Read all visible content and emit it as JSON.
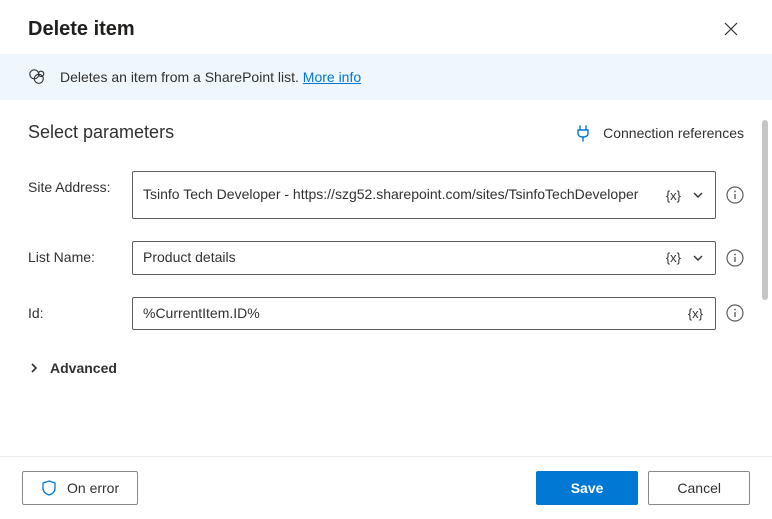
{
  "header": {
    "title": "Delete item"
  },
  "info": {
    "text": "Deletes an item from a SharePoint list. ",
    "link": "More info"
  },
  "section": {
    "title": "Select parameters",
    "connection_refs": "Connection references"
  },
  "fields": {
    "site_address": {
      "label": "Site Address:",
      "value": "Tsinfo Tech Developer - https://szg52.sharepoint.com/sites/TsinfoTechDeveloper",
      "fx": "{x}"
    },
    "list_name": {
      "label": "List Name:",
      "value": "Product details",
      "fx": "{x}"
    },
    "id": {
      "label": "Id:",
      "value": "%CurrentItem.ID%",
      "fx": "{x}"
    }
  },
  "advanced": {
    "label": "Advanced"
  },
  "footer": {
    "on_error": "On error",
    "save": "Save",
    "cancel": "Cancel"
  }
}
